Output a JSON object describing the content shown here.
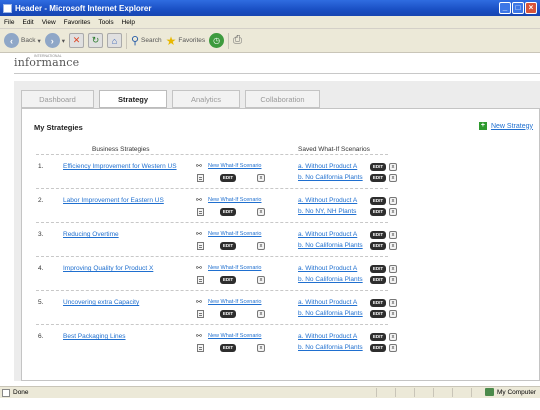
{
  "window": {
    "title": "Header - Microsoft Internet Explorer"
  },
  "menu": [
    "File",
    "Edit",
    "View",
    "Favorites",
    "Tools",
    "Help"
  ],
  "toolbar": {
    "back_label": "Back",
    "search_label": "Search",
    "favorites_label": "Favorites"
  },
  "brand": {
    "logo": "informance",
    "tagline": "INTERNATIONAL"
  },
  "tabs": [
    "Dashboard",
    "Strategy",
    "Analytics",
    "Collaboration"
  ],
  "panel": {
    "title": "My Strategies",
    "new_strategy": "New Strategy",
    "col_business": "Business Strategies",
    "col_saved": "Saved What-If Scenarios",
    "new_whatif": "New What-If Scenario",
    "edit": "EDIT",
    "x": "x"
  },
  "rows": [
    {
      "num": "1.",
      "name": "Efficiency Improvement for Western US",
      "scen_a": "a. Without Product A",
      "scen_b": "b. No California Plants"
    },
    {
      "num": "2.",
      "name": "Labor Improvement for Eastern US",
      "scen_a": "a. Without Product A",
      "scen_b": "b. No NY, NH Plants"
    },
    {
      "num": "3.",
      "name": "Reducing Overtime",
      "scen_a": "a. Without Product A",
      "scen_b": "b. No California Plants"
    },
    {
      "num": "4.",
      "name": "Improving Quality for Product X",
      "scen_a": "a. Without Product A",
      "scen_b": "b. No California Plants"
    },
    {
      "num": "5.",
      "name": "Uncovering extra Capacity",
      "scen_a": "a. Without Product A",
      "scen_b": "b. No California Plants"
    },
    {
      "num": "6.",
      "name": "Best Packaging Lines",
      "scen_a": "a. Without Product A",
      "scen_b": "b. No California Plants"
    }
  ],
  "status": {
    "left": "Done",
    "zone": "My Computer"
  }
}
